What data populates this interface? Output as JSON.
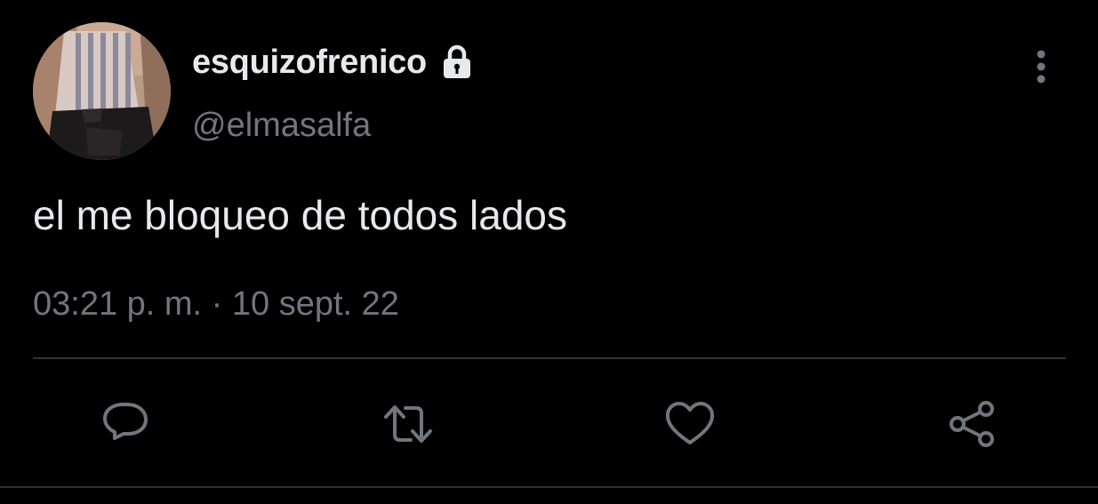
{
  "tweet": {
    "display_name": "esquizofrenico",
    "handle": "@elmasalfa",
    "text": "el me bloqueo de todos lados",
    "timestamp": "03:21 p. m. · 10 sept. 22"
  },
  "icons": {
    "lock": "lock-icon",
    "more": "more-vertical-icon",
    "reply": "reply-bubble-icon",
    "retweet": "retweet-icon",
    "like": "heart-icon",
    "share": "share-icon"
  },
  "colors": {
    "background": "#000000",
    "primary_text": "#e7e9ea",
    "secondary_text": "#71767b",
    "divider": "#2f3336",
    "icon": "#71767b"
  }
}
